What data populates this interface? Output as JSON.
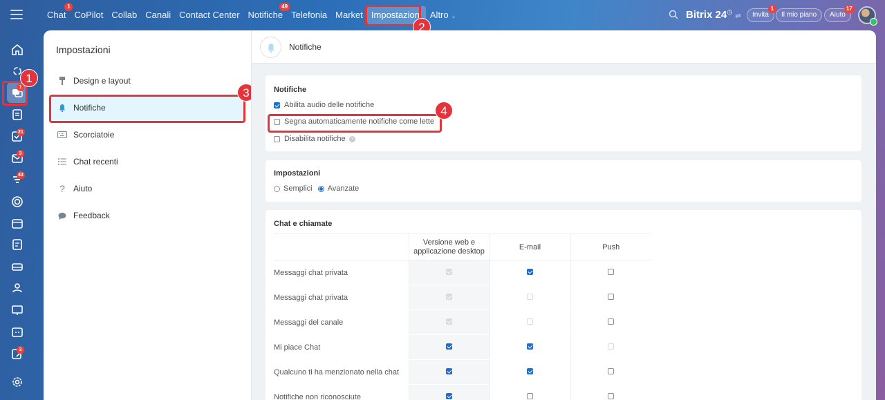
{
  "topbar": {
    "nav": [
      {
        "label": "Chat",
        "badge": "1"
      },
      {
        "label": "CoPilot",
        "badge": ""
      },
      {
        "label": "Collab",
        "badge": ""
      },
      {
        "label": "Canali",
        "badge": ""
      },
      {
        "label": "Contact Center",
        "badge": ""
      },
      {
        "label": "Notifiche",
        "badge": "49"
      },
      {
        "label": "Telefonia",
        "badge": ""
      },
      {
        "label": "Market",
        "badge": ""
      },
      {
        "label": "Impostazioni",
        "badge": "",
        "active": true
      },
      {
        "label": "Altro",
        "badge": "",
        "dropdown": true
      }
    ],
    "brand": "Bitrix 24",
    "invite_label": "Invita",
    "invite_badge": "1",
    "plan_label": "Il mio piano",
    "help_label": "Aiuto",
    "help_badge": "17"
  },
  "rail": {
    "badges": {
      "chat": "1",
      "tasks": "21",
      "mail": "3",
      "feed": "43",
      "other": "3"
    }
  },
  "annotations": {
    "step1": "1",
    "step2": "2",
    "step3": "3",
    "step4": "4"
  },
  "sidepanel": {
    "title": "Impostazioni",
    "items": [
      {
        "label": "Design e layout",
        "icon": "brush-icon"
      },
      {
        "label": "Notifiche",
        "icon": "bell-icon",
        "active": true
      },
      {
        "label": "Scorciatoie",
        "icon": "keyboard-icon"
      },
      {
        "label": "Chat recenti",
        "icon": "list-icon"
      },
      {
        "label": "Aiuto",
        "icon": "question-icon"
      },
      {
        "label": "Feedback",
        "icon": "speech-bubble-icon"
      }
    ]
  },
  "main": {
    "title": "Notifiche",
    "notifications_card": {
      "title": "Notifiche",
      "options": [
        {
          "label": "Abilita audio delle notifiche",
          "checked": true
        },
        {
          "label": "Segna automaticamente notifiche come lette",
          "checked": false
        },
        {
          "label": "Disabilita notifiche",
          "checked": false
        }
      ]
    },
    "settings_card": {
      "title": "Impostazioni",
      "radios": [
        {
          "label": "Semplici",
          "checked": false
        },
        {
          "label": "Avanzate",
          "checked": true
        }
      ]
    },
    "chat_card": {
      "title": "Chat e chiamate",
      "columns": [
        "Versione web e applicazione desktop",
        "E-mail",
        "Push"
      ],
      "rows": [
        {
          "label": "Messaggi chat privata",
          "web": "disabled-on",
          "email": "on",
          "push": "off"
        },
        {
          "label": "Messaggi chat privata",
          "web": "disabled-on",
          "email": "disabled-off",
          "push": "off"
        },
        {
          "label": "Messaggi del canale",
          "web": "disabled-on",
          "email": "disabled-off",
          "push": "off"
        },
        {
          "label": "Mi piace Chat",
          "web": "on",
          "email": "on",
          "push": "disabled-off"
        },
        {
          "label": "Qualcuno ti ha menzionato nella chat",
          "web": "on",
          "email": "on",
          "push": "off"
        },
        {
          "label": "Notifiche non riconosciute",
          "web": "on",
          "email": "off",
          "push": "off"
        }
      ]
    }
  }
}
